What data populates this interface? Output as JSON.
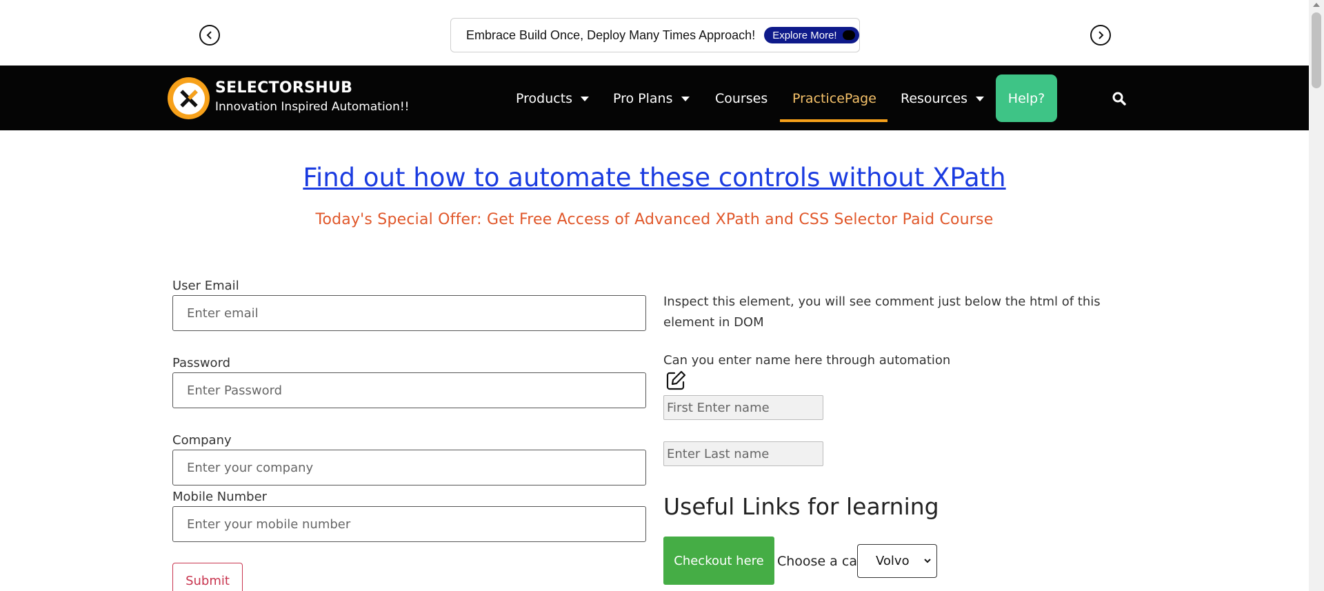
{
  "announcement": {
    "text": "Embrace Build Once, Deploy Many Times Approach!",
    "cta": "Explore More!",
    "prev_icon": "chevron-left-icon",
    "next_icon": "chevron-right-icon"
  },
  "brand": {
    "name": "SELECTORSHUB",
    "tagline": "Innovation Inspired Automation!!",
    "accent_color": "#f7a11a"
  },
  "nav": {
    "items": [
      {
        "label": "Products"
      },
      {
        "label": "Pro Plans"
      },
      {
        "label": "Courses"
      },
      {
        "label": "PracticePage"
      },
      {
        "label": "Resources"
      }
    ],
    "help_label": "Help?",
    "help_color": "#3ec486",
    "search_icon": "search-icon"
  },
  "hero": {
    "link_text": "Find out how to automate these controls without XPath",
    "offer_text": "Today's Special Offer: Get Free Access of Advanced XPath and CSS Selector Paid Course"
  },
  "form": {
    "email_label": "User Email",
    "email_placeholder": "Enter email",
    "password_label": "Password",
    "password_placeholder": "Enter Password",
    "company_label": "Company",
    "company_placeholder": "Enter your company",
    "mobile_label": "Mobile Number",
    "mobile_placeholder": "Enter your mobile number",
    "submit_label": "Submit"
  },
  "right": {
    "inspect_text": "Inspect this element, you will see comment just below the html of this element in DOM",
    "name_prompt": "Can you enter name here through automation",
    "first_name_placeholder": "First Enter name",
    "last_name_placeholder": "Enter Last name",
    "useful_heading": "Useful Links for learning",
    "checkout_label": "Checkout here",
    "car_label": "Choose a car:",
    "car_selected": "Volvo"
  }
}
